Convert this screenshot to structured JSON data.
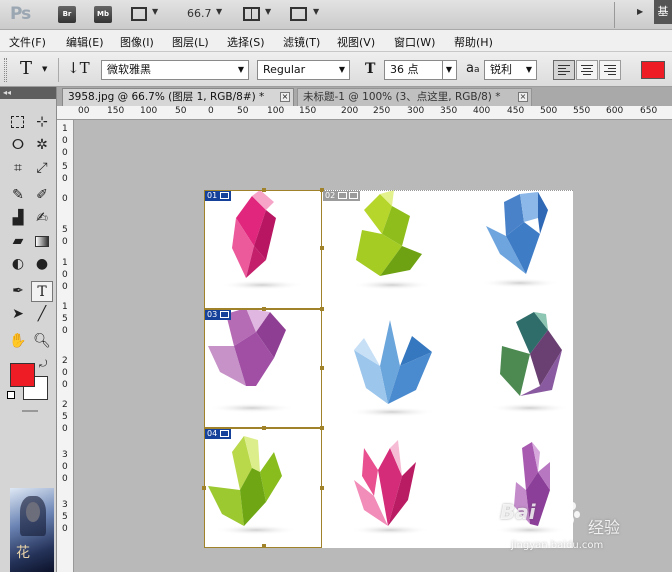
{
  "app_bar": {
    "logo": "Ps",
    "bridge_label": "Br",
    "minibridge_label": "Mb",
    "zoom": "66.7",
    "workspace": "基"
  },
  "menubar": [
    "文件(F)",
    "编辑(E)",
    "图像(I)",
    "图层(L)",
    "选择(S)",
    "滤镜(T)",
    "视图(V)",
    "窗口(W)",
    "帮助(H)"
  ],
  "options_bar": {
    "font_family": "微软雅黑",
    "font_style": "Regular",
    "font_size": "36 点",
    "aa_icon_label": "a",
    "aa_icon_label_sub": "a",
    "antialias": "锐利",
    "text_color": "#ee1c24"
  },
  "tabs": [
    {
      "label": "3958.jpg @ 66.7% (图层 1, RGB/8#) *"
    },
    {
      "label": "未标题-1 @ 100% (3、点这里, RGB/8) *"
    }
  ],
  "ruler_top": [
    "00",
    "150",
    "100",
    "50",
    "0",
    "50",
    "100",
    "150",
    "200",
    "250",
    "300",
    "350",
    "400",
    "450",
    "500",
    "550",
    "600",
    "650"
  ],
  "ruler_left": [
    "1",
    "0",
    "0",
    "5",
    "0",
    "0",
    "5",
    "0",
    "1",
    "0",
    "0",
    "1",
    "5",
    "0",
    "2",
    "0",
    "0",
    "2",
    "5",
    "0",
    "3",
    "0",
    "0",
    "3",
    "5",
    "0"
  ],
  "slices": [
    "01",
    "02",
    "03",
    "04"
  ],
  "watermark": {
    "brand": "Bai",
    "brand_cn": "经验",
    "url": "jingyan.baidu.com"
  },
  "colors": {
    "foreground": "#ee1c24",
    "background": "#ffffff",
    "slice_active": "#16419b",
    "slice_border": "#a0822a"
  }
}
